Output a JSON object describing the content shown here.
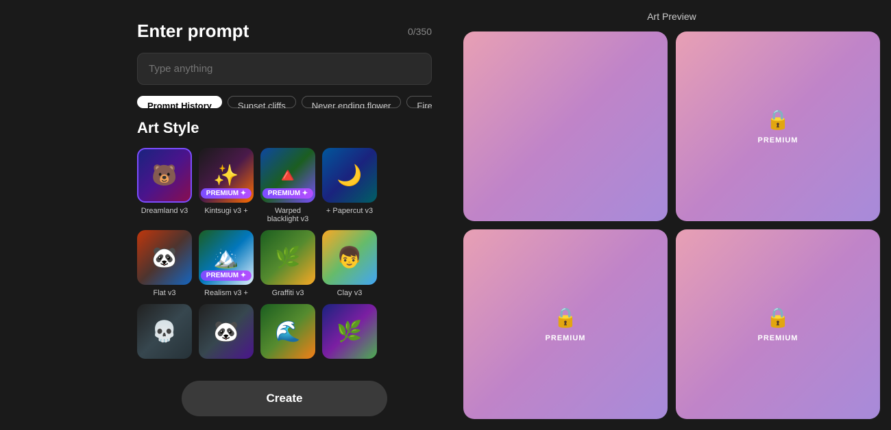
{
  "prompt": {
    "title": "Enter prompt",
    "char_count": "0/350",
    "placeholder": "Type anything",
    "input_value": ""
  },
  "tags": [
    {
      "label": "Prompt History",
      "active": true
    },
    {
      "label": "Sunset cliffs",
      "active": false
    },
    {
      "label": "Never ending flower",
      "active": false
    },
    {
      "label": "Fire and w",
      "active": false
    }
  ],
  "art_style": {
    "title": "Art Style",
    "items": [
      {
        "id": "dreamland",
        "label": "Dreamland v3",
        "premium": false,
        "selected": true,
        "thumb": "dreamland"
      },
      {
        "id": "kintsugi",
        "label": "Kintsugi v3",
        "premium": true,
        "selected": false,
        "thumb": "kintsugi"
      },
      {
        "id": "warped",
        "label": "Warped blacklight v3",
        "premium": true,
        "selected": false,
        "thumb": "warped"
      },
      {
        "id": "papercut",
        "label": "Papercut v3",
        "premium": false,
        "selected": false,
        "thumb": "papercut"
      },
      {
        "id": "flat",
        "label": "Flat v3",
        "premium": false,
        "selected": false,
        "thumb": "flat"
      },
      {
        "id": "realism",
        "label": "Realism v3",
        "premium": true,
        "selected": false,
        "thumb": "realism"
      },
      {
        "id": "graffiti",
        "label": "Graffiti v3",
        "premium": false,
        "selected": false,
        "thumb": "graffiti"
      },
      {
        "id": "clay",
        "label": "Clay v3",
        "premium": false,
        "selected": false,
        "thumb": "clay"
      },
      {
        "id": "row3a",
        "label": "",
        "premium": false,
        "selected": false,
        "thumb": "row3a"
      },
      {
        "id": "row3b",
        "label": "",
        "premium": false,
        "selected": false,
        "thumb": "row3b"
      },
      {
        "id": "row3c",
        "label": "",
        "premium": false,
        "selected": false,
        "thumb": "row3c"
      },
      {
        "id": "row3d",
        "label": "",
        "premium": false,
        "selected": false,
        "thumb": "row3d"
      }
    ]
  },
  "create_button": {
    "label": "Create"
  },
  "art_preview": {
    "title": "Art Preview",
    "cards": [
      {
        "locked": false
      },
      {
        "locked": true,
        "label": "PREMIUM"
      },
      {
        "locked": true,
        "label": "PREMIUM"
      },
      {
        "locked": true,
        "label": "PREMIUM"
      }
    ]
  }
}
